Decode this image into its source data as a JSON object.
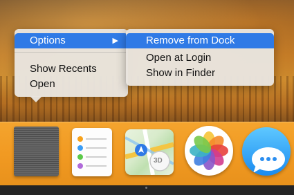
{
  "context_menu": {
    "items": [
      {
        "label": "Options",
        "has_submenu": true,
        "selected": true
      },
      {
        "label": "Show Recents"
      },
      {
        "label": "Open"
      }
    ],
    "submenu_arrow": "▶"
  },
  "submenu": {
    "items": [
      {
        "label": "Remove from Dock",
        "selected": true
      },
      {
        "label": "Open at Login"
      },
      {
        "label": "Show in Finder"
      }
    ]
  },
  "dock": {
    "apps": [
      {
        "name": "notes-app",
        "icon": "notes-icon"
      },
      {
        "name": "reminders-app",
        "icon": "reminders-icon"
      },
      {
        "name": "maps-app",
        "icon": "maps-icon",
        "badge_text": "3D"
      },
      {
        "name": "photos-app",
        "icon": "photos-icon"
      },
      {
        "name": "messages-app",
        "icon": "messages-icon"
      }
    ]
  },
  "colors": {
    "selection": "#2f7ae6",
    "dock": "#f19a22",
    "menu_bg": "#e8e4de"
  }
}
